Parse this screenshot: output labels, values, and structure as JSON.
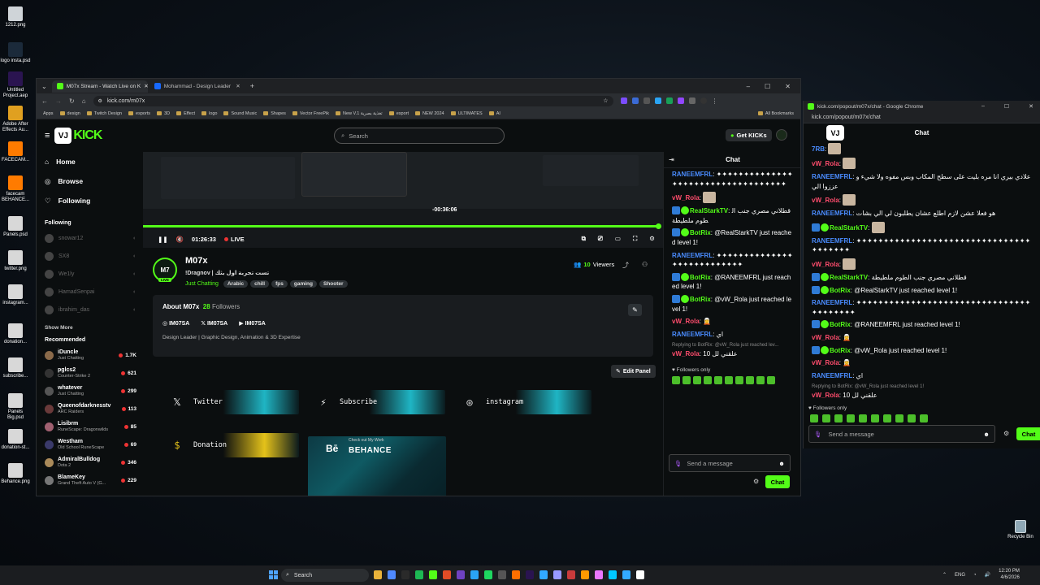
{
  "desktop": {
    "icons": [
      {
        "label": "1212.png",
        "color": "#cfd4d8"
      },
      {
        "label": "logo insta.psd",
        "color": "#1b2a3a"
      },
      {
        "label": "Untitled Project.aep",
        "color": "#2a1450"
      },
      {
        "label": "Adobe After Effects Au...",
        "color": "#e0a020"
      },
      {
        "label": "FACECAM...",
        "color": "#ff7b00"
      },
      {
        "label": "facecam BEHANCE...",
        "color": "#ff7b00"
      },
      {
        "label": "Panels.psd",
        "color": "#d8d8d8"
      },
      {
        "label": "twitter.png",
        "color": "#d8d8d8"
      },
      {
        "label": "instagram...",
        "color": "#d8d8d8"
      },
      {
        "label": "donation...",
        "color": "#d8d8d8"
      },
      {
        "label": "subscribe...",
        "color": "#d8d8d8"
      },
      {
        "label": "Panels Big.psd",
        "color": "#d8d8d8"
      },
      {
        "label": "donation-st...",
        "color": "#d8d8d8"
      },
      {
        "label": "Behance.png",
        "color": "#d8d8d8"
      }
    ],
    "recycle_bin": "Recycle Bin"
  },
  "browser": {
    "tabs": [
      {
        "label": "M07x Stream - Watch Live on K",
        "active": true,
        "color": "#53fc18"
      },
      {
        "label": "Mohammad - Design Leader",
        "active": false,
        "color": "#1769ff"
      }
    ],
    "new_tab": "+",
    "window_controls": [
      "–",
      "☐",
      "✕"
    ],
    "url": "kick.com/m07x",
    "bookmarks": [
      "Apps",
      "design",
      "Twitch Design",
      "esports",
      "3D",
      "Effect",
      "logo",
      "Sound Music",
      "Shapes",
      "Vector FreePik",
      "New V.1 تغذية بصرية",
      "esport",
      "NEW 2024",
      "ULTIMATES",
      "AI"
    ],
    "all_bookmarks": "All Bookmarks"
  },
  "kick": {
    "logo_text": "KICK",
    "logo_mark": "VJ",
    "search_placeholder": "Search",
    "get_kicks": "Get KICKs",
    "nav": [
      {
        "label": "Home",
        "icon": "home-icon"
      },
      {
        "label": "Browse",
        "icon": "compass-icon"
      },
      {
        "label": "Following",
        "icon": "heart-icon"
      }
    ],
    "following_header": "Following",
    "following": [
      "snowar12",
      "SX8",
      "We1ly",
      "HamadSenpai",
      "ibrahim_das"
    ],
    "show_more": "Show More",
    "recommended_header": "Recommended",
    "recommended": [
      {
        "name": "iDuncle",
        "category": "Just Chatting",
        "viewers": "1.7K",
        "color": "#8a6a4a"
      },
      {
        "name": "pglcs2",
        "category": "Counter-Strike 2",
        "viewers": "621",
        "color": "#333"
      },
      {
        "name": "whatever",
        "category": "Just Chatting",
        "viewers": "299",
        "color": "#555"
      },
      {
        "name": "Queenofdarknesstv",
        "category": "ARC Raiders",
        "viewers": "113",
        "color": "#6a3a3a"
      },
      {
        "name": "Lisibrm",
        "category": "RuneScape: Dragonwilds",
        "viewers": "85",
        "color": "#a06070"
      },
      {
        "name": "Westham",
        "category": "Old School RuneScape",
        "viewers": "69",
        "color": "#3a3a6a"
      },
      {
        "name": "AdmiralBulldog",
        "category": "Dota 2",
        "viewers": "346",
        "color": "#aa8a5a"
      },
      {
        "name": "BlameKey",
        "category": "Grand Theft Auto V (G...",
        "viewers": "229",
        "color": "#777"
      }
    ],
    "player": {
      "hover_time": "-00:36:06",
      "current_time": "01:26:33",
      "live_label": "LIVE",
      "progress": 0.99
    },
    "stream": {
      "avatar_text": "M7",
      "live_badge": "LIVE",
      "name": "M07x",
      "title": "!Dragnov | تست تجربة اول بثك",
      "category": "Just Chatting",
      "tags": [
        "Arabic",
        "chill",
        "fps",
        "gaming",
        "Shooter"
      ],
      "viewers_count": "10",
      "viewers_label": "Viewers"
    },
    "about": {
      "title": "About M07x",
      "followers_count": "28",
      "followers_label": "Followers",
      "socials": [
        {
          "icon": "instagram-icon",
          "label": "IM07SA"
        },
        {
          "icon": "x-icon",
          "label": "IM07SA"
        },
        {
          "icon": "youtube-icon",
          "label": "IM07SA"
        }
      ],
      "bio": "Design Leader | Graphic Design, Animation & 3D Expertise"
    },
    "edit_panel": "Edit Panel",
    "panels": [
      {
        "label": "Twitter",
        "icon": "x-icon",
        "accent": "#1fb5c4"
      },
      {
        "label": "Subscribe",
        "icon": "bolt-icon",
        "accent": "#1fb5c4"
      },
      {
        "label": "instagram",
        "icon": "instagram-icon",
        "accent": "#1fb5c4"
      },
      {
        "label": "Donation",
        "icon": "dollar-icon",
        "accent": "#e4c21a"
      }
    ],
    "behance_panel": {
      "small": "Check out My Work",
      "title": "BEHANCE",
      "mark": "Bē"
    }
  },
  "chat": {
    "title": "Chat",
    "messages": [
      {
        "user": "RANEEMFRL",
        "color": "#4a8cff",
        "text": "✦✦✦✦✦✦✦✦✦✦✦✦✦✦✦✦✦✦✦✦✦✦✦✦✦✦✦✦✦✦✦✦✦✦✦"
      },
      {
        "user": "vW_Rola",
        "color": "#ff4d6d",
        "text": "",
        "emote": true
      },
      {
        "user": "RealStarkTV",
        "color": "#53fc18",
        "text": "قطلاني مصري جنب الطوم ملطيطة"
      },
      {
        "user": "BotRix",
        "color": "#53fc18",
        "text": "@RealStarkTV just reached level 1!"
      },
      {
        "user": "RANEEMFRL",
        "color": "#4a8cff",
        "text": "✦✦✦✦✦✦✦✦✦✦✦✦✦✦✦✦✦✦✦✦✦✦✦✦✦✦✦"
      },
      {
        "user": "BotRix",
        "color": "#53fc18",
        "text": "@RANEEMFRL just reached level 1!"
      },
      {
        "user": "BotRix",
        "color": "#53fc18",
        "text": "@vW_Rola just reached level 1!"
      },
      {
        "user": "vW_Rola",
        "color": "#ff4d6d",
        "text": "🧝"
      },
      {
        "user": "RANEEMFRL",
        "color": "#4a8cff",
        "text": "اي"
      },
      {
        "reply": "Replying to BotRix: @vW_Rola just reached lev...",
        "user": "vW_Rola",
        "color": "#ff4d6d",
        "text": "علقني لل 10"
      }
    ],
    "followers_only": "Followers only",
    "input_placeholder": "Send a message",
    "send_label": "Chat"
  },
  "popout": {
    "window_title": "kick.com/popout/m07x/chat - Google Chrome",
    "url": "kick.com/popout/m07x/chat",
    "title": "Chat",
    "messages": [
      {
        "user": "7RB",
        "color": "#4a8cff",
        "text": "",
        "emote": true
      },
      {
        "user": "vW_Rola",
        "color": "#ff4d6d",
        "text": "",
        "emote": true
      },
      {
        "user": "RANEEMFRL",
        "color": "#4a8cff",
        "text": "علادي بيري انا مره بليت على سطح المكاب وبس مفوه ولا شيء وعززوا الي"
      },
      {
        "user": "vW_Rola",
        "color": "#ff4d6d",
        "text": "",
        "emote": true
      },
      {
        "user": "RANEEMFRL",
        "color": "#4a8cff",
        "text": "هو فعلا عشن لازم اطلع عشان يطلبون لي الي بشات"
      },
      {
        "user": "RealStarkTV",
        "color": "#53fc18",
        "text": "",
        "emote": true
      },
      {
        "user": "RANEEMFRL",
        "color": "#4a8cff",
        "text": "✦✦✦✦✦✦✦✦✦✦✦✦✦✦✦✦✦✦✦✦✦✦✦✦✦✦✦✦✦✦✦✦✦✦✦✦✦✦✦"
      },
      {
        "user": "vW_Rola",
        "color": "#ff4d6d",
        "text": "",
        "emote": true
      },
      {
        "user": "RealStarkTV",
        "color": "#53fc18",
        "text": "قطلاني مصري جنب الطوم ملطيطة"
      },
      {
        "user": "BotRix",
        "color": "#53fc18",
        "text": "@RealStarkTV just reached level 1!"
      },
      {
        "user": "RANEEMFRL",
        "color": "#4a8cff",
        "text": "✦✦✦✦✦✦✦✦✦✦✦✦✦✦✦✦✦✦✦✦✦✦✦✦✦✦✦✦✦✦✦✦✦✦✦✦✦✦✦✦"
      },
      {
        "user": "BotRix",
        "color": "#53fc18",
        "text": "@RANEEMFRL just reached level 1!"
      },
      {
        "user": "vW_Rola",
        "color": "#ff4d6d",
        "text": "🧝"
      },
      {
        "user": "BotRix",
        "color": "#53fc18",
        "text": "@vW_Rola just reached level 1!"
      },
      {
        "user": "vW_Rola",
        "color": "#ff4d6d",
        "text": "🧝"
      },
      {
        "user": "RANEEMFRL",
        "color": "#4a8cff",
        "text": "اي"
      },
      {
        "reply": "Replying to BotRix: @vW_Rola just reached level 1!",
        "user": "vW_Rola",
        "color": "#ff4d6d",
        "text": "علقني لل 10"
      }
    ],
    "followers_only": "Followers only",
    "input_placeholder": "Send a message",
    "send_label": "Chat"
  },
  "taskbar": {
    "search_placeholder": "Search",
    "lang": "ENG",
    "time": "12:20 PM",
    "date": "4/6/2026"
  }
}
